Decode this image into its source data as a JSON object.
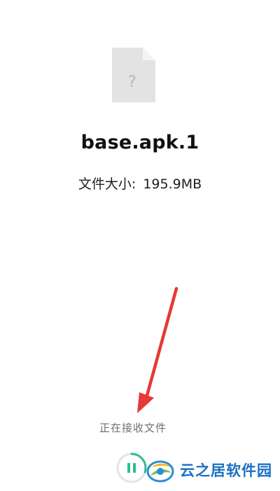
{
  "file": {
    "name": "base.apk.1",
    "size_label": "文件大小:",
    "size_value": "195.9MB",
    "icon": "unknown-file-icon",
    "icon_glyph": "?"
  },
  "transfer": {
    "status": "正在接收文件",
    "control_icon": "pause-icon",
    "accent_color": "#2dbd8c",
    "progress_fraction": 0.3
  },
  "watermark": {
    "text": "云之居软件园",
    "logo": "yunzhiju-logo"
  },
  "annotation": {
    "type": "arrow",
    "color": "#e53935"
  }
}
